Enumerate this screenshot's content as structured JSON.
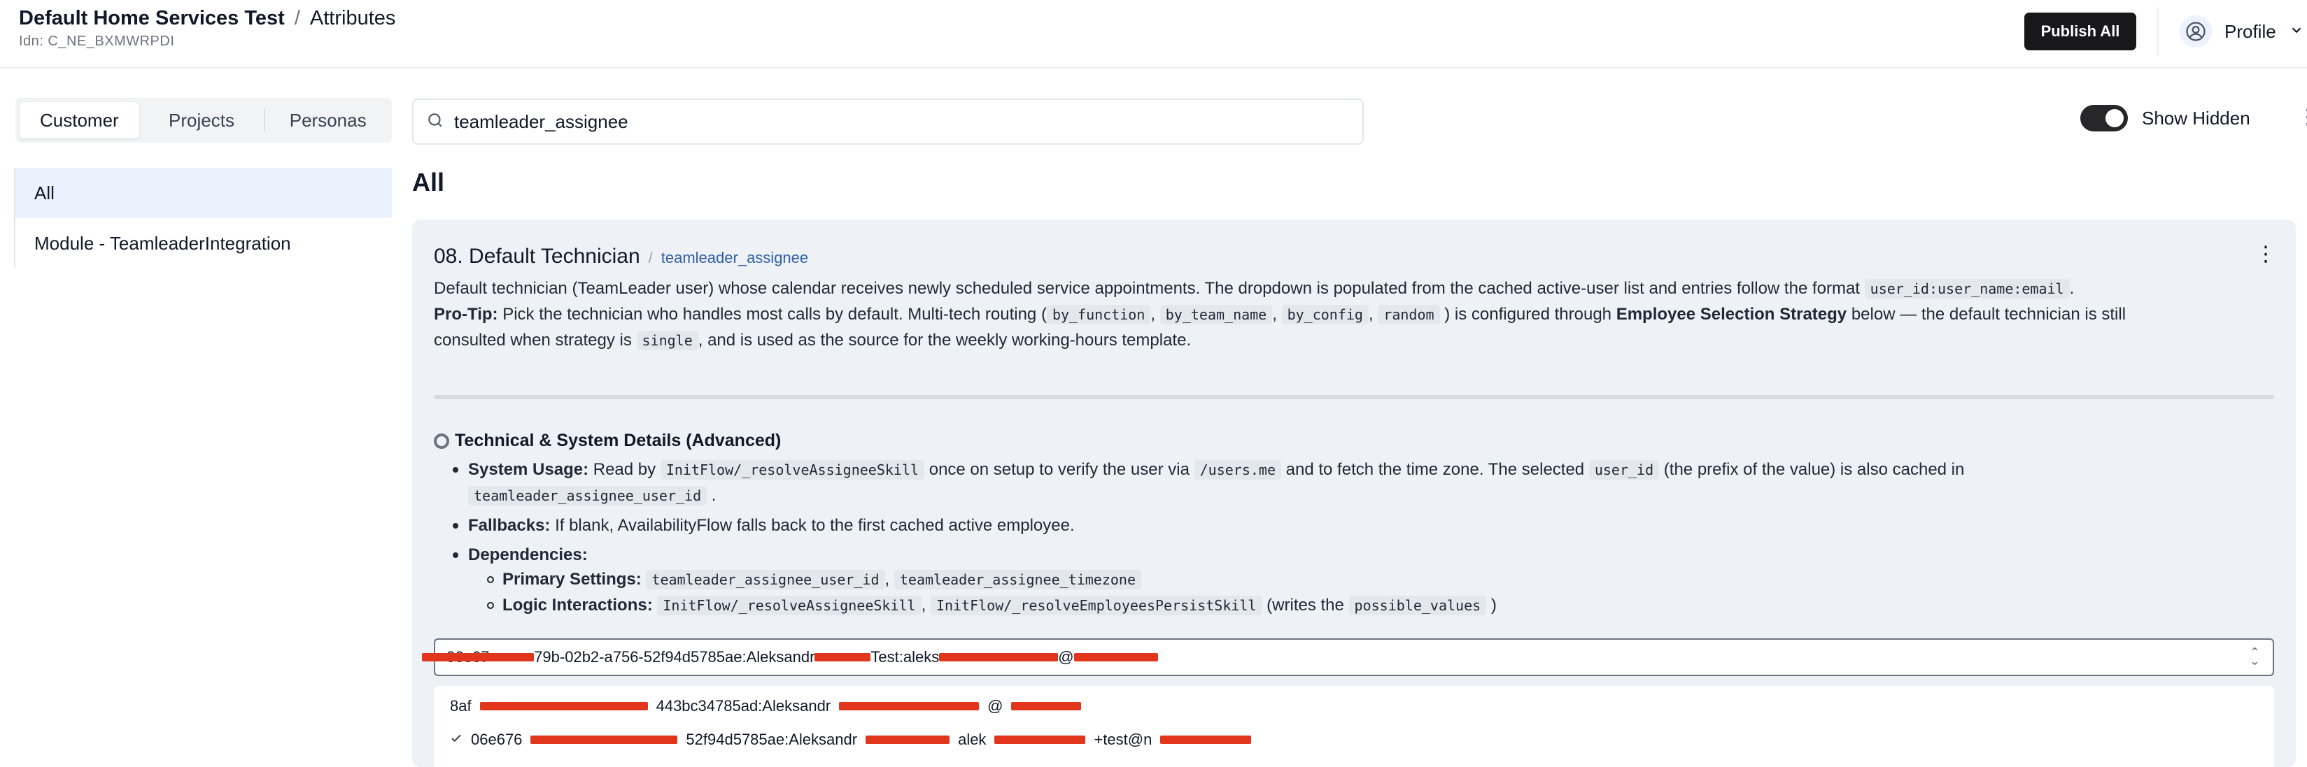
{
  "header": {
    "breadcrumb_root": "Default Home Services Test",
    "breadcrumb_sep": "/",
    "breadcrumb_current": "Attributes",
    "idn": "Idn: C_NE_BXMWRPDI",
    "publish_label": "Publish All",
    "profile_label": "Profile"
  },
  "sidebar": {
    "tabs": [
      {
        "label": "Customer",
        "active": true
      },
      {
        "label": "Projects",
        "active": false
      },
      {
        "label": "Personas",
        "active": false
      }
    ],
    "items": [
      {
        "label": "All",
        "active": true
      },
      {
        "label": "Module - TeamleaderIntegration",
        "active": false
      }
    ]
  },
  "search": {
    "value": "teamleader_assignee"
  },
  "show_hidden": {
    "label": "Show Hidden",
    "on": true
  },
  "section_title": "All",
  "card": {
    "title": "08. Default Technician",
    "slash": "/",
    "key": "teamleader_assignee",
    "desc_text": "Default technician (TeamLeader user) whose calendar receives newly scheduled service appointments. The dropdown is populated from the cached active-user list and entries follow the format",
    "desc_code": "user_id:user_name:email",
    "protip_label": "Pro-Tip:",
    "protip_1": "Pick the technician who handles most calls by default. Multi-tech routing (",
    "protip_codes": [
      "by_function",
      "by_team_name",
      "by_config",
      "random"
    ],
    "protip_2": ") is configured through",
    "protip_bold": "Employee Selection Strategy",
    "protip_3": "below — the default technician is still",
    "protip_4": "consulted when strategy is",
    "protip_code_single": "single",
    "protip_5": ", and is used as the source for the weekly working-hours template.",
    "tech_heading": "Technical & System Details (Advanced)",
    "system_usage_label": "System Usage:",
    "system_usage_1": "Read by",
    "system_usage_code1": "InitFlow/_resolveAssigneeSkill",
    "system_usage_2": "once on setup to verify the user via",
    "system_usage_code2": "/users.me",
    "system_usage_3": "and to fetch the time zone. The selected",
    "system_usage_code3": "user_id",
    "system_usage_4": "(the prefix of the value) is also cached in",
    "system_usage_code4": "teamleader_assignee_user_id",
    "fallbacks_label": "Fallbacks:",
    "fallbacks_text": "If blank, AvailabilityFlow falls back to the first cached active employee.",
    "dependencies_label": "Dependencies:",
    "primary_label": "Primary Settings:",
    "primary_codes": [
      "teamleader_assignee_user_id",
      "teamleader_assignee_timezone"
    ],
    "logic_label": "Logic Interactions:",
    "logic_codes": [
      "InitFlow/_resolveAssigneeSkill",
      "InitFlow/_resolveEmployeesPersistSkill"
    ],
    "logic_1": "(writes the",
    "logic_code3": "possible_values",
    "logic_2": ")",
    "select_value_a": "06e67",
    "select_value_b": "79b-02b2-a756-52f94d5785ae:Aleksandr",
    "select_value_c": "Test:aleks",
    "select_value_d": "@",
    "options": [
      {
        "a": "8af",
        "b": "443bc34785ad:Aleksandr",
        "c": "@",
        "checked": false
      },
      {
        "a": "06e676",
        "b": "52f94d5785ae:Aleksandr",
        "c": "alek",
        "d": "+test@n",
        "checked": true
      }
    ]
  }
}
